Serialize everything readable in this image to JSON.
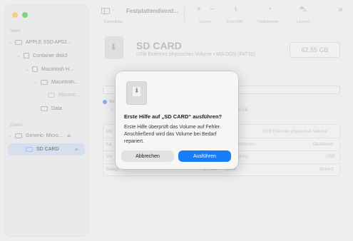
{
  "sidebar": {
    "section_internal": "Intern",
    "section_external": "Extern",
    "items": [
      {
        "label": "APPLE SSD AP02..."
      },
      {
        "label": "Container disk3"
      },
      {
        "label": "Macintosh H..."
      },
      {
        "label": "Macintosh..."
      },
      {
        "label": "Macinto..."
      },
      {
        "label": "Data"
      },
      {
        "label": "Generic- Micro..."
      },
      {
        "label": "SD CARD"
      }
    ]
  },
  "toolbar": {
    "title": "Festplattendienst...",
    "labels": {
      "view": "Darstellung",
      "volume": "Volume",
      "first_aid": "Erste Hilfe",
      "partition": "Partitionieren",
      "erase": "Löschen"
    }
  },
  "volume": {
    "name": "SD CARD",
    "description": "USB Externes physisches Volume • MS-DOS (FAT32)",
    "size": "62,55 GB"
  },
  "background_fragments": {
    "legend_short": "Be",
    "legend_s": "S",
    "size_tail": "4 GB",
    "row1_left": "Mo",
    "row1_right": "USB Externes physisches Volume",
    "row2_left": "Ka",
    "row2_mid": "tümer:in:",
    "row2_right": "Deaktiviert",
    "row3_left": "Ver",
    "row3_mid": "dung:",
    "row3_right": "USB",
    "row4_left": "Belegt:",
    "row4_mid_val": "2,7 MB",
    "row4_mid": "Gerät:",
    "row4_right": "disk4s1"
  },
  "dialog": {
    "title": "Erste Hilfe auf „SD CARD“ ausführen?",
    "body": "Erste Hilfe überprüft das Volume auf Fehler. Anschließend wird das Volume bei Bedarf repariert.",
    "cancel_label": "Abbrechen",
    "run_label": "Ausführen"
  }
}
